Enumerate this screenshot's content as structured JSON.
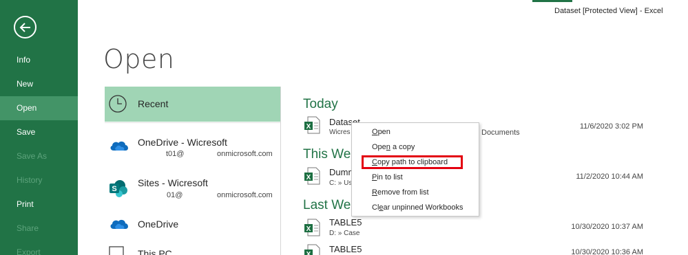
{
  "window": {
    "title": "Dataset  [Protected View] - Excel"
  },
  "sidebar": {
    "items": [
      {
        "label": "Info",
        "state": "normal"
      },
      {
        "label": "New",
        "state": "normal"
      },
      {
        "label": "Open",
        "state": "active"
      },
      {
        "label": "Save",
        "state": "normal"
      },
      {
        "label": "Save As",
        "state": "disabled"
      },
      {
        "label": "History",
        "state": "disabled"
      },
      {
        "label": "Print",
        "state": "normal"
      },
      {
        "label": "Share",
        "state": "disabled"
      },
      {
        "label": "Export",
        "state": "disabled"
      }
    ]
  },
  "page": {
    "title": "Open"
  },
  "locations": [
    {
      "label": "Recent",
      "icon": "clock-icon"
    },
    {
      "label": "OneDrive - Wicresoft",
      "sub_start": "t01@",
      "sub_end": "onmicrosoft.com",
      "icon": "onedrive-cloud-icon"
    },
    {
      "label": "Sites - Wicresoft",
      "sub_start": "01@",
      "sub_end": "onmicrosoft.com",
      "icon": "sharepoint-icon"
    },
    {
      "label": "OneDrive",
      "icon": "onedrive-cloud-icon"
    },
    {
      "label": "This PC",
      "icon": "computer-icon"
    }
  ],
  "recent": {
    "groups": [
      {
        "heading": "Today",
        "files": [
          {
            "name": "Dataset",
            "path": "Wicres",
            "path_tail": "Documents",
            "date": "11/6/2020 3:02 PM"
          }
        ]
      },
      {
        "heading": "This Wee",
        "files": [
          {
            "name": "Dumm",
            "path": "C: » Us",
            "date": "11/2/2020 10:44 AM"
          }
        ]
      },
      {
        "heading": "Last Wee",
        "files": [
          {
            "name": "TABLE5",
            "path": "D: » Case",
            "date": "10/30/2020 10:37 AM"
          },
          {
            "name": "TABLE5",
            "path": "",
            "date": "10/30/2020 10:36 AM"
          }
        ]
      }
    ]
  },
  "context_menu": {
    "items": [
      {
        "label": "Open",
        "accel": "O",
        "rest": "pen"
      },
      {
        "label": "Open a copy",
        "accel": "",
        "pre": "Ope",
        "mid": "n",
        "rest": " a copy"
      },
      {
        "label": "Copy path to clipboard",
        "accel": "C",
        "rest": "opy path to clipboard",
        "highlighted": true
      },
      {
        "label": "Pin to list",
        "accel": "P",
        "rest": "in to list"
      },
      {
        "label": "Remove from list",
        "accel": "R",
        "rest": "emove from list"
      },
      {
        "label": "Clear unpinned Workbooks",
        "accel": "",
        "pre": "Cl",
        "mid": "e",
        "rest": "ar unpinned Workbooks"
      }
    ]
  },
  "colors": {
    "accent": "#217346",
    "sidebar_active": "#439467",
    "selected": "#a0d5b5",
    "highlight_box": "#e3000f"
  }
}
